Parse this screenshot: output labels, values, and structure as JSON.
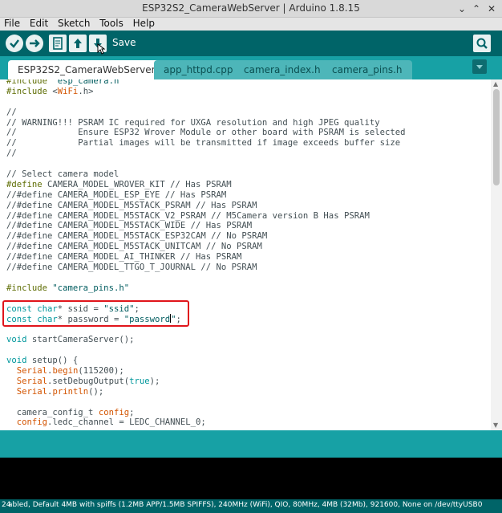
{
  "window": {
    "title": "ESP32S2_CameraWebServer | Arduino 1.8.15"
  },
  "menu": [
    "File",
    "Edit",
    "Sketch",
    "Tools",
    "Help"
  ],
  "toolbar": {
    "save_label": "Save"
  },
  "tabs": [
    "ESP32S2_CameraWebServer §",
    "app_httpd.cpp",
    "camera_index.h",
    "camera_pins.h"
  ],
  "editor": {
    "lines": [
      [
        {
          "t": "#include ",
          "c": "pp"
        },
        {
          "t": "\"esp_camera.h\"",
          "c": "str"
        }
      ],
      [
        {
          "t": "#include ",
          "c": "pp"
        },
        {
          "t": "<",
          "c": ""
        },
        {
          "t": "WiFi",
          "c": "fn"
        },
        {
          "t": ".h>",
          "c": ""
        }
      ],
      [],
      [
        {
          "t": "//",
          "c": ""
        }
      ],
      [
        {
          "t": "// WARNING!!! PSRAM IC required for UXGA resolution and high JPEG quality",
          "c": ""
        }
      ],
      [
        {
          "t": "//            Ensure ESP32 Wrover Module or other board with PSRAM is selected",
          "c": ""
        }
      ],
      [
        {
          "t": "//            Partial images will be transmitted if image exceeds buffer size",
          "c": ""
        }
      ],
      [
        {
          "t": "//",
          "c": ""
        }
      ],
      [],
      [
        {
          "t": "// Select camera model",
          "c": ""
        }
      ],
      [
        {
          "t": "#define ",
          "c": "pp"
        },
        {
          "t": "CAMERA_MODEL_WROVER_KIT // Has PSRAM",
          "c": ""
        }
      ],
      [
        {
          "t": "//#define CAMERA_MODEL_ESP_EYE // Has PSRAM",
          "c": ""
        }
      ],
      [
        {
          "t": "//#define CAMERA_MODEL_M5STACK_PSRAM // Has PSRAM",
          "c": ""
        }
      ],
      [
        {
          "t": "//#define CAMERA_MODEL_M5STACK_V2_PSRAM // M5Camera version B Has PSRAM",
          "c": ""
        }
      ],
      [
        {
          "t": "//#define CAMERA_MODEL_M5STACK_WIDE // Has PSRAM",
          "c": ""
        }
      ],
      [
        {
          "t": "//#define CAMERA_MODEL_M5STACK_ESP32CAM // No PSRAM",
          "c": ""
        }
      ],
      [
        {
          "t": "//#define CAMERA_MODEL_M5STACK_UNITCAM // No PSRAM",
          "c": ""
        }
      ],
      [
        {
          "t": "//#define CAMERA_MODEL_AI_THINKER // Has PSRAM",
          "c": ""
        }
      ],
      [
        {
          "t": "//#define CAMERA_MODEL_TTGO_T_JOURNAL // No PSRAM",
          "c": ""
        }
      ],
      [],
      [
        {
          "t": "#include ",
          "c": "pp"
        },
        {
          "t": "\"camera_pins.h\"",
          "c": "str"
        }
      ],
      [],
      [
        {
          "t": "const ",
          "c": "kw"
        },
        {
          "t": "char",
          "c": "kw"
        },
        {
          "t": "* ssid = ",
          "c": ""
        },
        {
          "t": "\"ssid\"",
          "c": "str"
        },
        {
          "t": ";",
          "c": ""
        }
      ],
      [
        {
          "t": "const ",
          "c": "kw"
        },
        {
          "t": "char",
          "c": "kw"
        },
        {
          "t": "* password = ",
          "c": ""
        },
        {
          "t": "\"password",
          "c": "str"
        },
        {
          "t": "CARET",
          "c": "caret"
        },
        {
          "t": "\"",
          "c": "str"
        },
        {
          "t": ";",
          "c": ""
        }
      ],
      [],
      [
        {
          "t": "void ",
          "c": "kw"
        },
        {
          "t": "startCameraServer();",
          "c": ""
        }
      ],
      [],
      [
        {
          "t": "void ",
          "c": "kw"
        },
        {
          "t": "setup",
          "c": ""
        },
        {
          "t": "() {",
          "c": ""
        }
      ],
      [
        {
          "t": "  ",
          "c": ""
        },
        {
          "t": "Serial",
          "c": "fn"
        },
        {
          "t": ".",
          "c": ""
        },
        {
          "t": "begin",
          "c": "fn"
        },
        {
          "t": "(115200);",
          "c": ""
        }
      ],
      [
        {
          "t": "  ",
          "c": ""
        },
        {
          "t": "Serial",
          "c": "fn"
        },
        {
          "t": ".setDebugOutput(",
          "c": ""
        },
        {
          "t": "true",
          "c": "kw"
        },
        {
          "t": ");",
          "c": ""
        }
      ],
      [
        {
          "t": "  ",
          "c": ""
        },
        {
          "t": "Serial",
          "c": "fn"
        },
        {
          "t": ".",
          "c": ""
        },
        {
          "t": "println",
          "c": "fn"
        },
        {
          "t": "();",
          "c": ""
        }
      ],
      [],
      [
        {
          "t": "  camera_config_t ",
          "c": ""
        },
        {
          "t": "config",
          "c": "fn"
        },
        {
          "t": ";",
          "c": ""
        }
      ],
      [
        {
          "t": "  ",
          "c": ""
        },
        {
          "t": "config",
          "c": "fn"
        },
        {
          "t": ".ledc_channel = LEDC_CHANNEL_0;",
          "c": ""
        }
      ]
    ]
  },
  "status": {
    "line_number": "24",
    "board_info": "abled, Default 4MB with spiffs (1.2MB APP/1.5MB SPIFFS), 240MHz (WiFi), QIO, 80MHz, 4MB (32Mb), 921600, None on /dev/ttyUSB0"
  },
  "colors": {
    "toolbar": "#006468",
    "tabbar": "#17a1a5",
    "highlight": "#e0151b"
  },
  "icons": [
    "verify-icon",
    "upload-icon",
    "new-icon",
    "open-icon",
    "save-icon",
    "serial-monitor-icon",
    "tab-menu-icon"
  ]
}
